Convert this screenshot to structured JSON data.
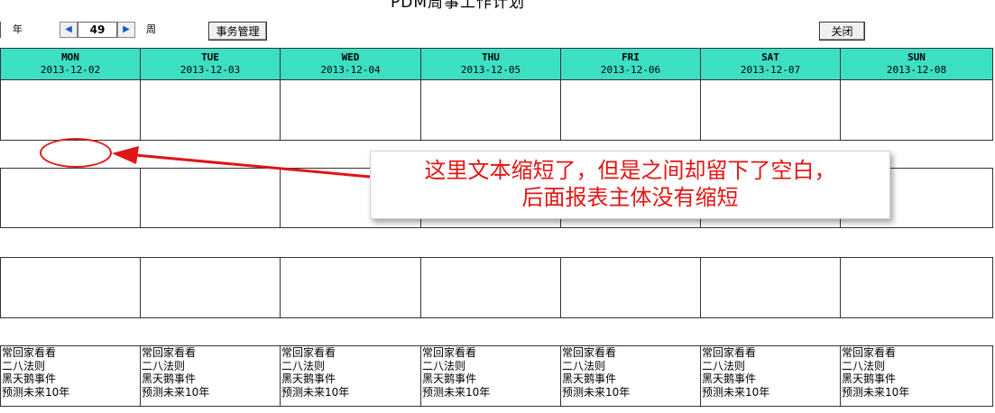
{
  "title": "PDM周事工作计划",
  "toolbar": {
    "year_label": "年",
    "week_value": "49",
    "week_label": "周",
    "task_button": "事务管理",
    "close_button": "关闭",
    "prev_icon": "triangle-left",
    "next_icon": "triangle-right"
  },
  "colors": {
    "header_bg": "#3ddfc3",
    "annotation": "#e01515",
    "spin_arrow": "#1f56c8"
  },
  "days": [
    {
      "name": "MON",
      "date": "2013-12-02"
    },
    {
      "name": "TUE",
      "date": "2013-12-03"
    },
    {
      "name": "WED",
      "date": "2013-12-04"
    },
    {
      "name": "THU",
      "date": "2013-12-05"
    },
    {
      "name": "FRI",
      "date": "2013-12-06"
    },
    {
      "name": "SAT",
      "date": "2013-12-07"
    },
    {
      "name": "SUN",
      "date": "2013-12-08"
    }
  ],
  "events": [
    "常回家看看",
    "二八法则",
    "黑天鹅事件",
    "预测未来10年"
  ],
  "annotation": {
    "line1": "这里文本缩短了，但是之间却留下了空白，",
    "line2": "后面报表主体没有缩短"
  }
}
